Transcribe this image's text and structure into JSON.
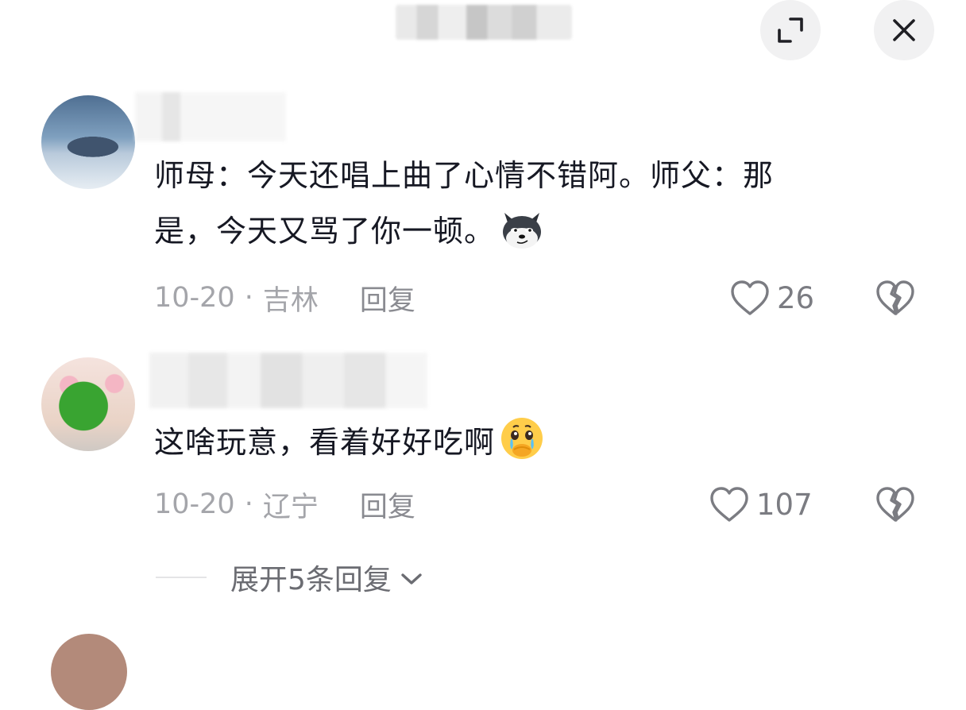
{
  "topbar": {
    "expand_icon": "expand-icon",
    "close_icon": "close-icon"
  },
  "comments": [
    {
      "text_line1": "师母：今天还唱上曲了心情不错阿。师父：那",
      "text_line2": "是，今天又骂了你一顿。",
      "emoji": "smirking-husky-emoji",
      "date": "10-20",
      "separator": "·",
      "location": "吉林",
      "reply_label": "回复",
      "like_count": "26"
    },
    {
      "text_line1": "这啥玩意，看着好好吃啊",
      "emoji": "holding-back-tears-emoji",
      "date": "10-20",
      "separator": "·",
      "location": "辽宁",
      "reply_label": "回复",
      "like_count": "107"
    }
  ],
  "expand_replies": {
    "label": "展开5条回复"
  },
  "colors": {
    "text": "#161823",
    "meta": "#a4a5aa",
    "icon": "#7b7c82",
    "button_bg": "#f1f1f2"
  }
}
